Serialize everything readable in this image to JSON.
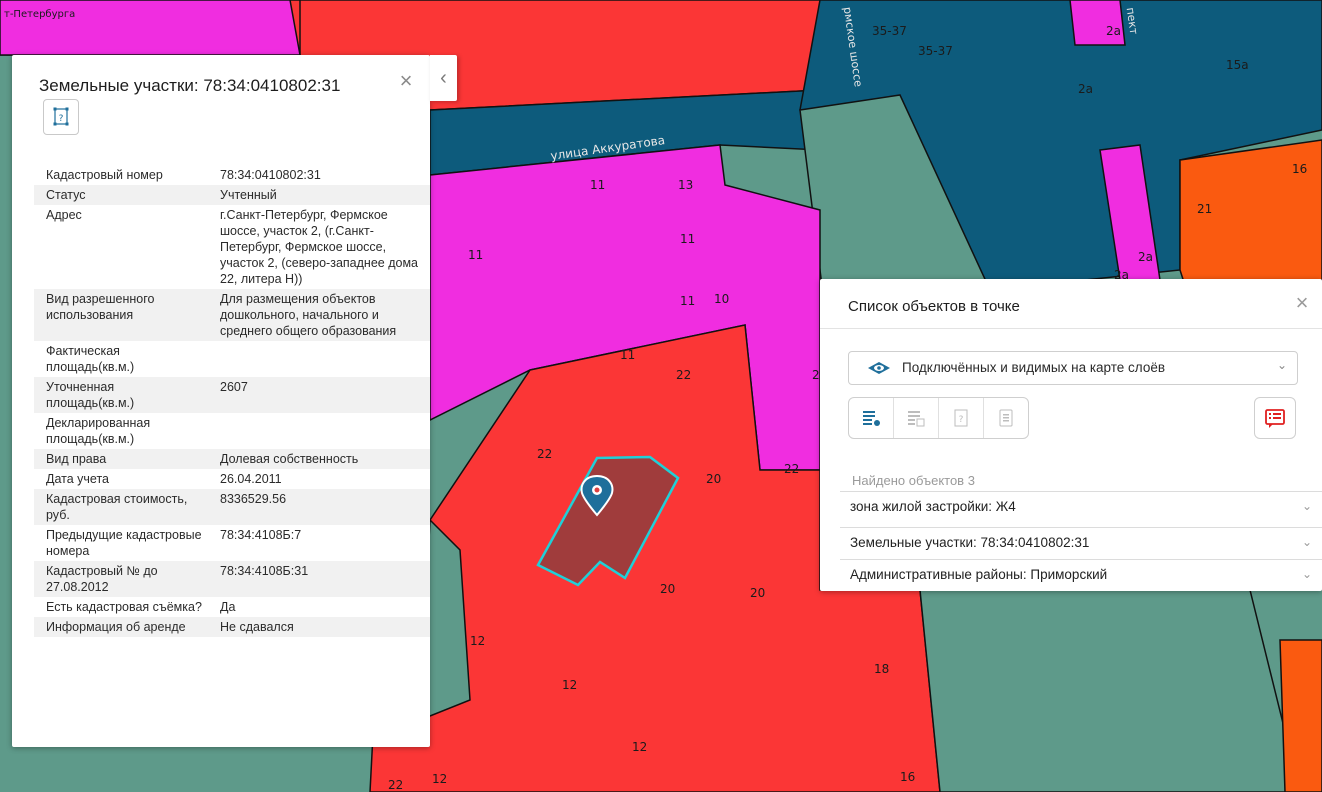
{
  "map": {
    "corner_text": "т-Петербурга",
    "street_labels": [
      "улица Аккуратова",
      "рмское шоссе",
      "пект"
    ],
    "parcel_labels": [
      "35-37",
      "35-37",
      "2а",
      "15а",
      "2а",
      "16",
      "21",
      "2а",
      "2а",
      "11",
      "13",
      "11",
      "11",
      "11",
      "10",
      "11",
      "22",
      "2",
      "22",
      "20",
      "22",
      "20",
      "20",
      "12",
      "12",
      "18",
      "12",
      "16",
      "22",
      "12"
    ],
    "colors": {
      "residential_zone": "#f02de0",
      "admin_red": "#fb3636",
      "block_dark": "#0d5b7c",
      "green_gray": "#5e9a8a",
      "orange": "#fa5a10",
      "selected_parcel": "#a03c3c",
      "selected_outline": "#1fd0d8",
      "marker": "#1f6f9b"
    }
  },
  "info_panel": {
    "title": "Земельные участки: 78:34:0410802:31",
    "close_icon": "close-icon",
    "shape_icon": "parcel-shape-icon",
    "rows": [
      {
        "key": "Кадастровый номер",
        "value": "78:34:0410802:31"
      },
      {
        "key": "Статус",
        "value": "Учтенный"
      },
      {
        "key": "Адрес",
        "value": "г.Санкт-Петербург, Фермское шоссе, участок 2, (г.Санкт-Петербург, Фермское шоссе, участок 2, (северо-западнее дома 22, литера Н))"
      },
      {
        "key": "Вид разрешенного использования",
        "value": "Для размещения объектов дошкольного, начального и среднего общего образования"
      },
      {
        "key": "Фактическая площадь(кв.м.)",
        "value": ""
      },
      {
        "key": "Уточненная площадь(кв.м.)",
        "value": "2607"
      },
      {
        "key": "Декларированная площадь(кв.м.)",
        "value": ""
      },
      {
        "key": "Вид права",
        "value": "Долевая собственность"
      },
      {
        "key": "Дата учета",
        "value": "26.04.2011"
      },
      {
        "key": "Кадастровая стоимость, руб.",
        "value": "8336529.56"
      },
      {
        "key": "Предыдущие кадастровые номера",
        "value": "78:34:4108Б:7"
      },
      {
        "key": "Кадастровый № до 27.08.2012",
        "value": "78:34:4108Б:31"
      },
      {
        "key": "Есть кадастровая съёмка?",
        "value": "Да"
      },
      {
        "key": "Информация об аренде",
        "value": "Не сдавался"
      }
    ]
  },
  "list_panel": {
    "title": "Список объектов в точке",
    "layer_select": "Подключённых и видимых на карте слоёв",
    "found": "Найдено объектов 3",
    "results": [
      "зона жилой застройки: Ж4",
      "Земельные участки: 78:34:0410802:31",
      "Административные районы: Приморский"
    ]
  }
}
